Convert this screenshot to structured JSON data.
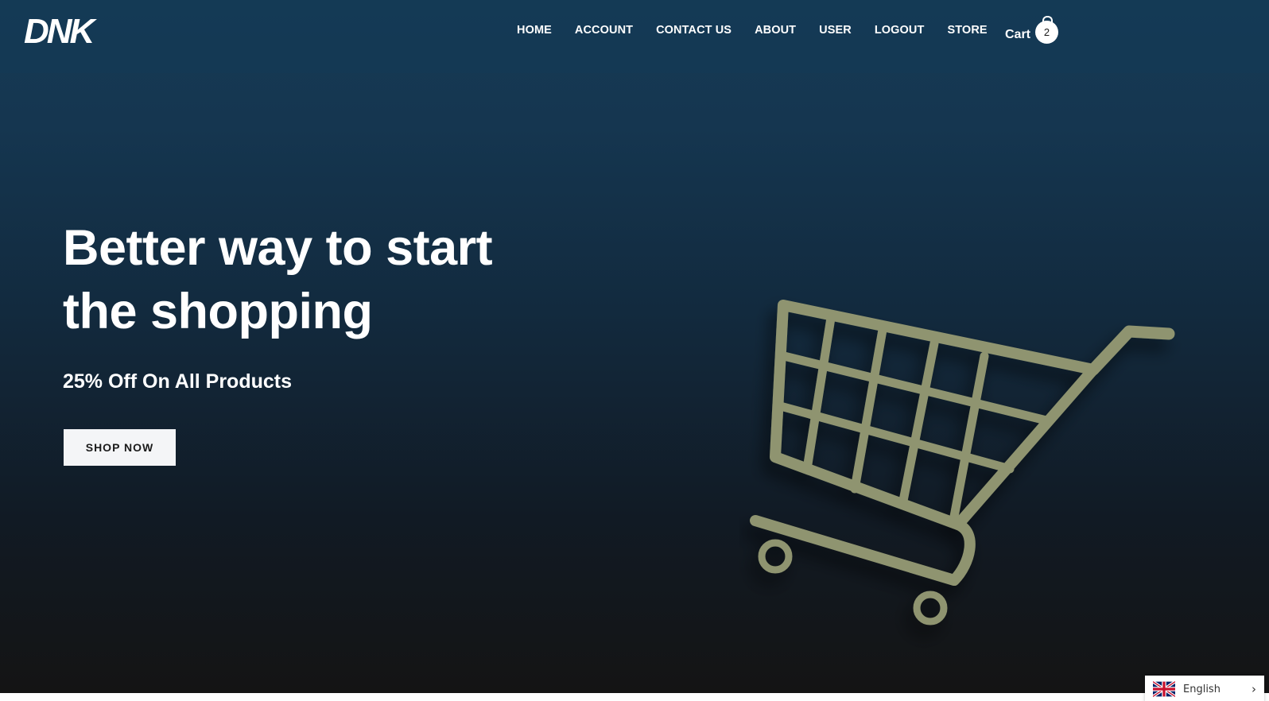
{
  "brand": {
    "logo_text": "DNK"
  },
  "nav": {
    "items": [
      {
        "label": "HOME"
      },
      {
        "label": "ACCOUNT"
      },
      {
        "label": "CONTACT US"
      },
      {
        "label": "ABOUT"
      },
      {
        "label": "USER"
      },
      {
        "label": "LOGOUT"
      },
      {
        "label": "STORE"
      }
    ],
    "cart": {
      "label": "Cart",
      "count": "2",
      "icon": "shopping-bag-icon"
    }
  },
  "hero": {
    "headline_line1": "Better way to start",
    "headline_line2": "the shopping",
    "subheadline": "25% Off On All Products",
    "cta_label": "SHOP NOW",
    "image_icon": "shopping-cart-icon"
  },
  "language_selector": {
    "label": "English",
    "flag_icon": "uk-flag-icon",
    "chevron_icon": "chevron-right-icon"
  },
  "colors": {
    "hero_top": "#163a55",
    "hero_bottom": "#141414",
    "cart_art": "#8f9470",
    "button_bg": "#f4f5f7"
  }
}
